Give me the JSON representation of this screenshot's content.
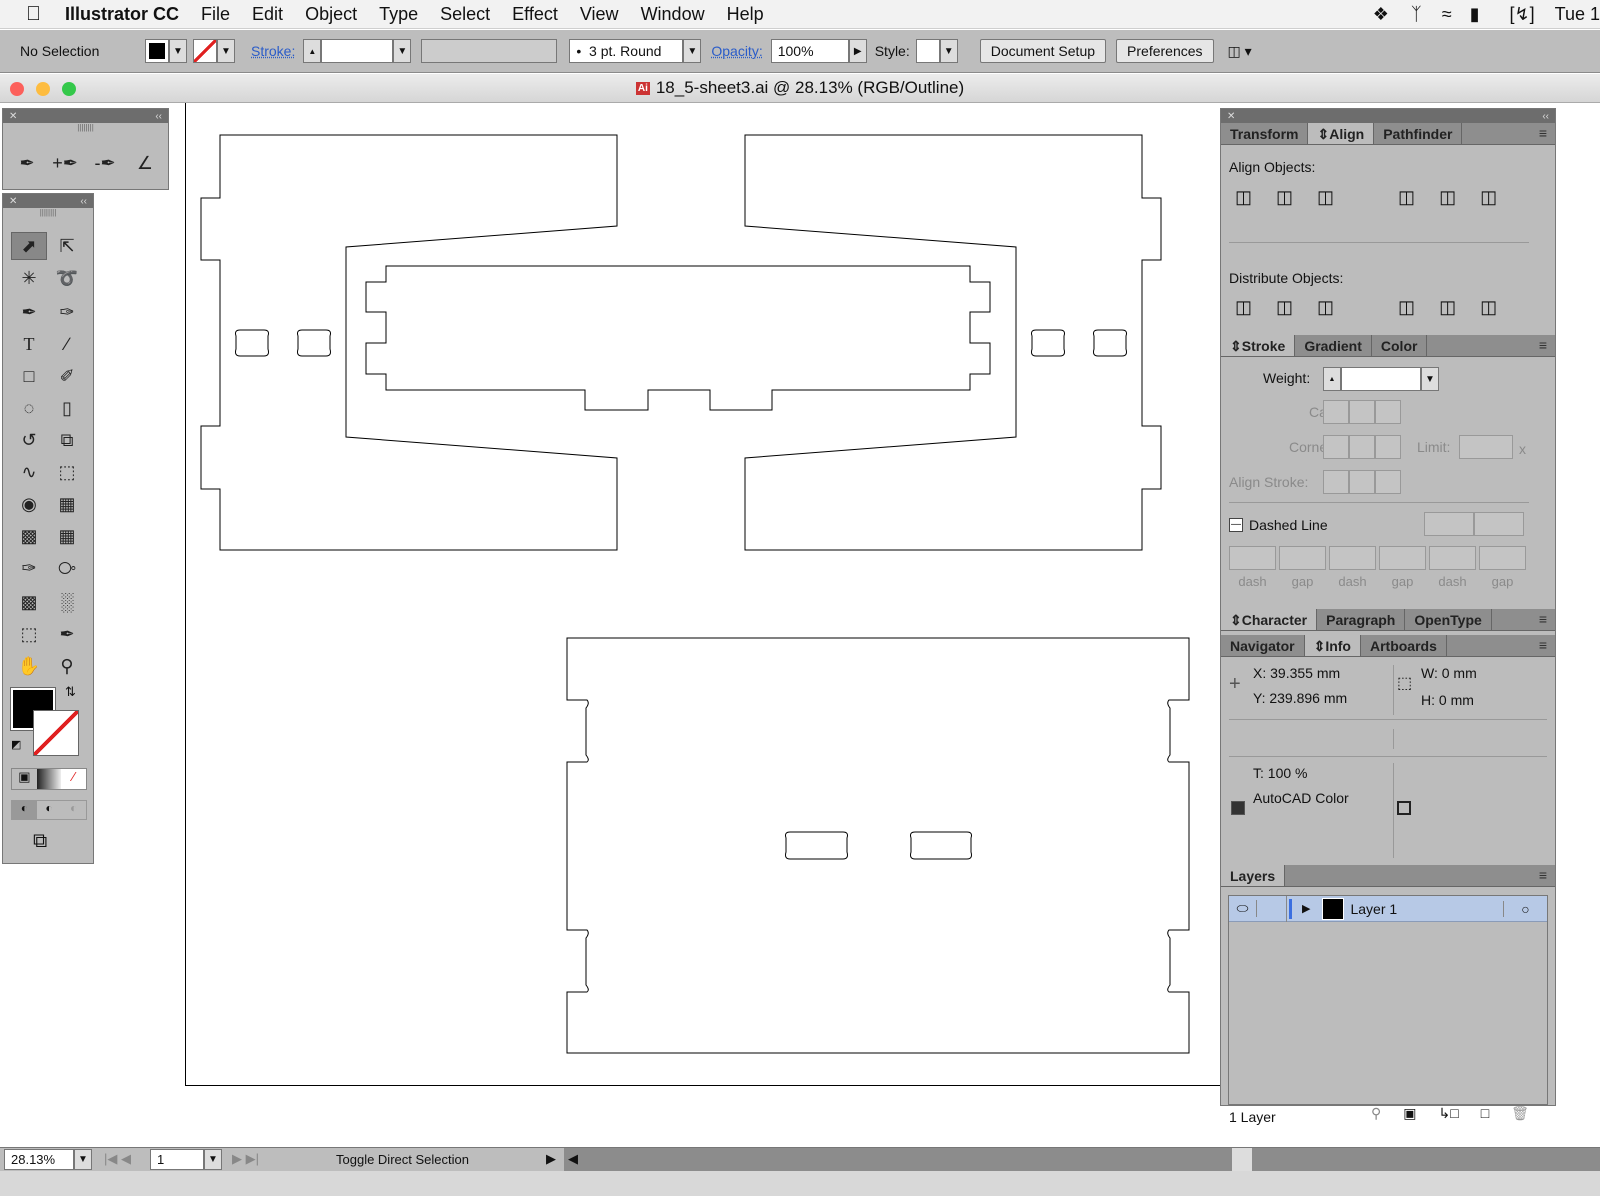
{
  "menubar": {
    "app": "Illustrator CC",
    "items": [
      "File",
      "Edit",
      "Object",
      "Type",
      "Select",
      "Effect",
      "View",
      "Window",
      "Help"
    ],
    "clock": "Tue 1"
  },
  "control": {
    "selection": "No Selection",
    "stroke_label": "Stroke:",
    "brush": "3 pt. Round",
    "opacity_label": "Opacity:",
    "opacity": "100%",
    "style_label": "Style:",
    "document_setup": "Document Setup",
    "preferences": "Preferences"
  },
  "document": {
    "title": "18_5-sheet3.ai @ 28.13% (RGB/Outline)"
  },
  "align_panel": {
    "tabs": [
      "Transform",
      "Align",
      "Pathfinder"
    ],
    "align_objects": "Align Objects:",
    "distribute_objects": "Distribute Objects:"
  },
  "stroke_panel": {
    "tabs": [
      "Stroke",
      "Gradient",
      "Color"
    ],
    "weight": "Weight:",
    "cap": "Cap:",
    "corner": "Corner:",
    "limit": "Limit:",
    "limit_unit": "x",
    "align_stroke": "Align Stroke:",
    "dashed_line": "Dashed Line",
    "dash_labels": [
      "dash",
      "gap",
      "dash",
      "gap",
      "dash",
      "gap"
    ]
  },
  "character_panel": {
    "tabs": [
      "Character",
      "Paragraph",
      "OpenType"
    ]
  },
  "info_panel": {
    "tabs": [
      "Navigator",
      "Info",
      "Artboards"
    ],
    "x": "X:  39.355 mm",
    "y": "Y:  239.896 mm",
    "w": "W:   0 mm",
    "h": "H:  0 mm",
    "t": "T: 100 %",
    "color_mode": "AutoCAD Color"
  },
  "layers_panel": {
    "tab": "Layers",
    "layer_name": "Layer 1",
    "count": "1 Layer"
  },
  "status": {
    "zoom": "28.13%",
    "artboard": "1",
    "tool_hint": "Toggle Direct Selection"
  },
  "colors": {
    "fill": "#000000",
    "stroke_none": "#e02020",
    "selected_layer": "#b7c9e6"
  }
}
